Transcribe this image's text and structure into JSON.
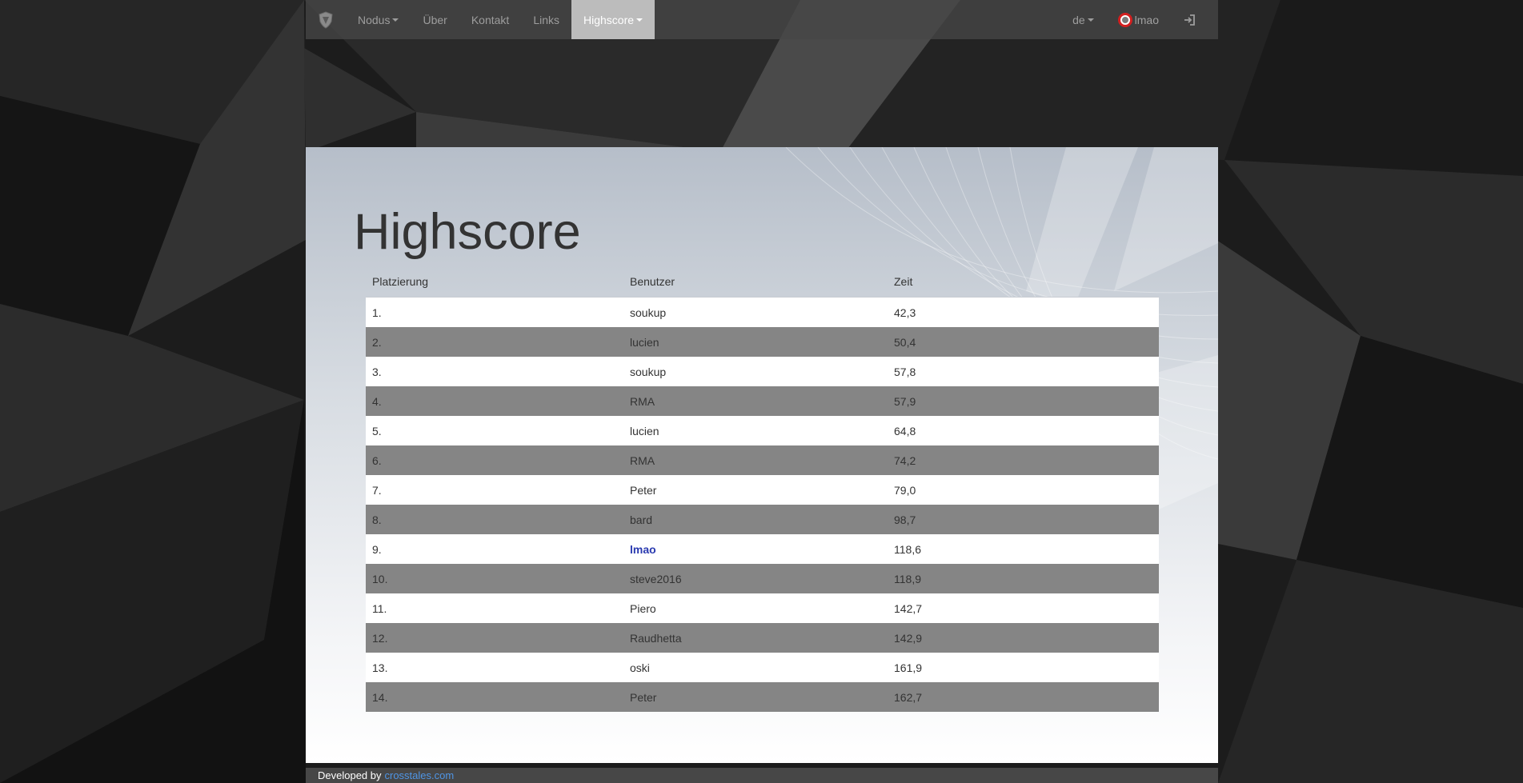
{
  "navbar": {
    "logo_icon": "shield-logo-icon",
    "items": [
      {
        "label": "Nodus",
        "dropdown": true
      },
      {
        "label": "Über",
        "dropdown": false
      },
      {
        "label": "Kontakt",
        "dropdown": false
      },
      {
        "label": "Links",
        "dropdown": false
      },
      {
        "label": "Highscore",
        "dropdown": true,
        "active": true
      }
    ],
    "language": "de",
    "user": "lmao",
    "signin_icon": "sign-in-icon"
  },
  "main": {
    "title": "Highscore",
    "columns": [
      "Platzierung",
      "Benutzer",
      "Zeit"
    ],
    "rows": [
      {
        "rank": "1.",
        "user": "soukup",
        "time": "42,3"
      },
      {
        "rank": "2.",
        "user": "lucien",
        "time": "50,4"
      },
      {
        "rank": "3.",
        "user": "soukup",
        "time": "57,8"
      },
      {
        "rank": "4.",
        "user": "RMA",
        "time": "57,9"
      },
      {
        "rank": "5.",
        "user": "lucien",
        "time": "64,8"
      },
      {
        "rank": "6.",
        "user": "RMA",
        "time": "74,2"
      },
      {
        "rank": "7.",
        "user": "Peter",
        "time": "79,0"
      },
      {
        "rank": "8.",
        "user": "bard",
        "time": "98,7"
      },
      {
        "rank": "9.",
        "user": "lmao",
        "time": "118,6",
        "highlight": true
      },
      {
        "rank": "10.",
        "user": "steve2016",
        "time": "118,9"
      },
      {
        "rank": "11.",
        "user": "Piero",
        "time": "142,7"
      },
      {
        "rank": "12.",
        "user": "Raudhetta",
        "time": "142,9"
      },
      {
        "rank": "13.",
        "user": "oski",
        "time": "161,9"
      },
      {
        "rank": "14.",
        "user": "Peter",
        "time": "162,7"
      }
    ]
  },
  "footer": {
    "text": "Developed by",
    "link": "crosstales.com"
  },
  "colors": {
    "highlight_user": "#2a3ab0",
    "row_alt": "#858585",
    "nav_active": "#bcbcbc",
    "footer_link": "#4f95e5"
  }
}
